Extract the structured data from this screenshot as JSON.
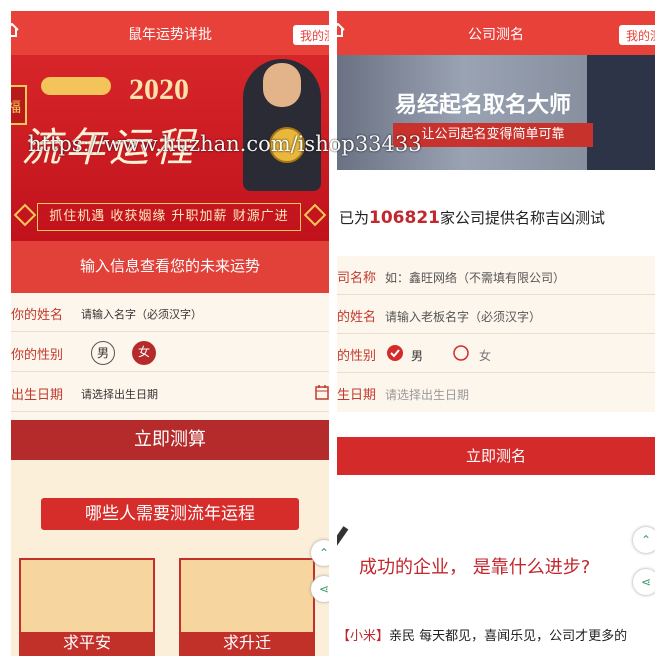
{
  "left": {
    "header": {
      "title": "鼠年运势详批",
      "my_button": "我的测"
    },
    "banner": {
      "year": "2020",
      "calligraphy": "流年运程",
      "fu_char": "福",
      "tags": "抓住机遇 收获姻缘 升职加薪 财源广进"
    },
    "subtitle": "输入信息查看您的未来运势",
    "form": {
      "name_label": "你的姓名",
      "name_placeholder": "请输入名字（必须汉字）",
      "gender_label": "你的性别",
      "gender_male": "男",
      "gender_female": "女",
      "birth_label": "出生日期",
      "birth_placeholder": "请选择出生日期"
    },
    "submit_button": "立即测算",
    "section_banner": "哪些人需要测流年运程",
    "cards": [
      "求平安",
      "求升迁"
    ]
  },
  "right": {
    "header": {
      "title": "公司测名",
      "my_button": "我的测"
    },
    "banner": {
      "title": "易经起名取名大师",
      "subtitle": "让公司起名变得简单可靠"
    },
    "count_prefix": "已为",
    "count_number": "106821",
    "count_suffix": "家公司提供名称吉凶测试",
    "form": {
      "company_label": "司名称",
      "company_placeholder": "如：鑫旺网络（不需填有限公司）",
      "boss_label": "的姓名",
      "boss_placeholder": "请输入老板名字（必须汉字）",
      "gender_label": "的性别",
      "gender_male": "男",
      "gender_female": "女",
      "birth_label": "生日期",
      "birth_placeholder": "请选择出生日期"
    },
    "submit_button": "立即测名",
    "article_heading": "成功的企业， 是靠什么进步?",
    "article_tag": "【小米】",
    "article_text": "亲民 每天都见，喜闻乐见，公司才更多的"
  },
  "watermark": "https://www.huzhan.com/ishop33433",
  "colors": {
    "primary_red": "#e8413a",
    "dark_red": "#b52b2b",
    "cream": "#fdf6ec"
  }
}
